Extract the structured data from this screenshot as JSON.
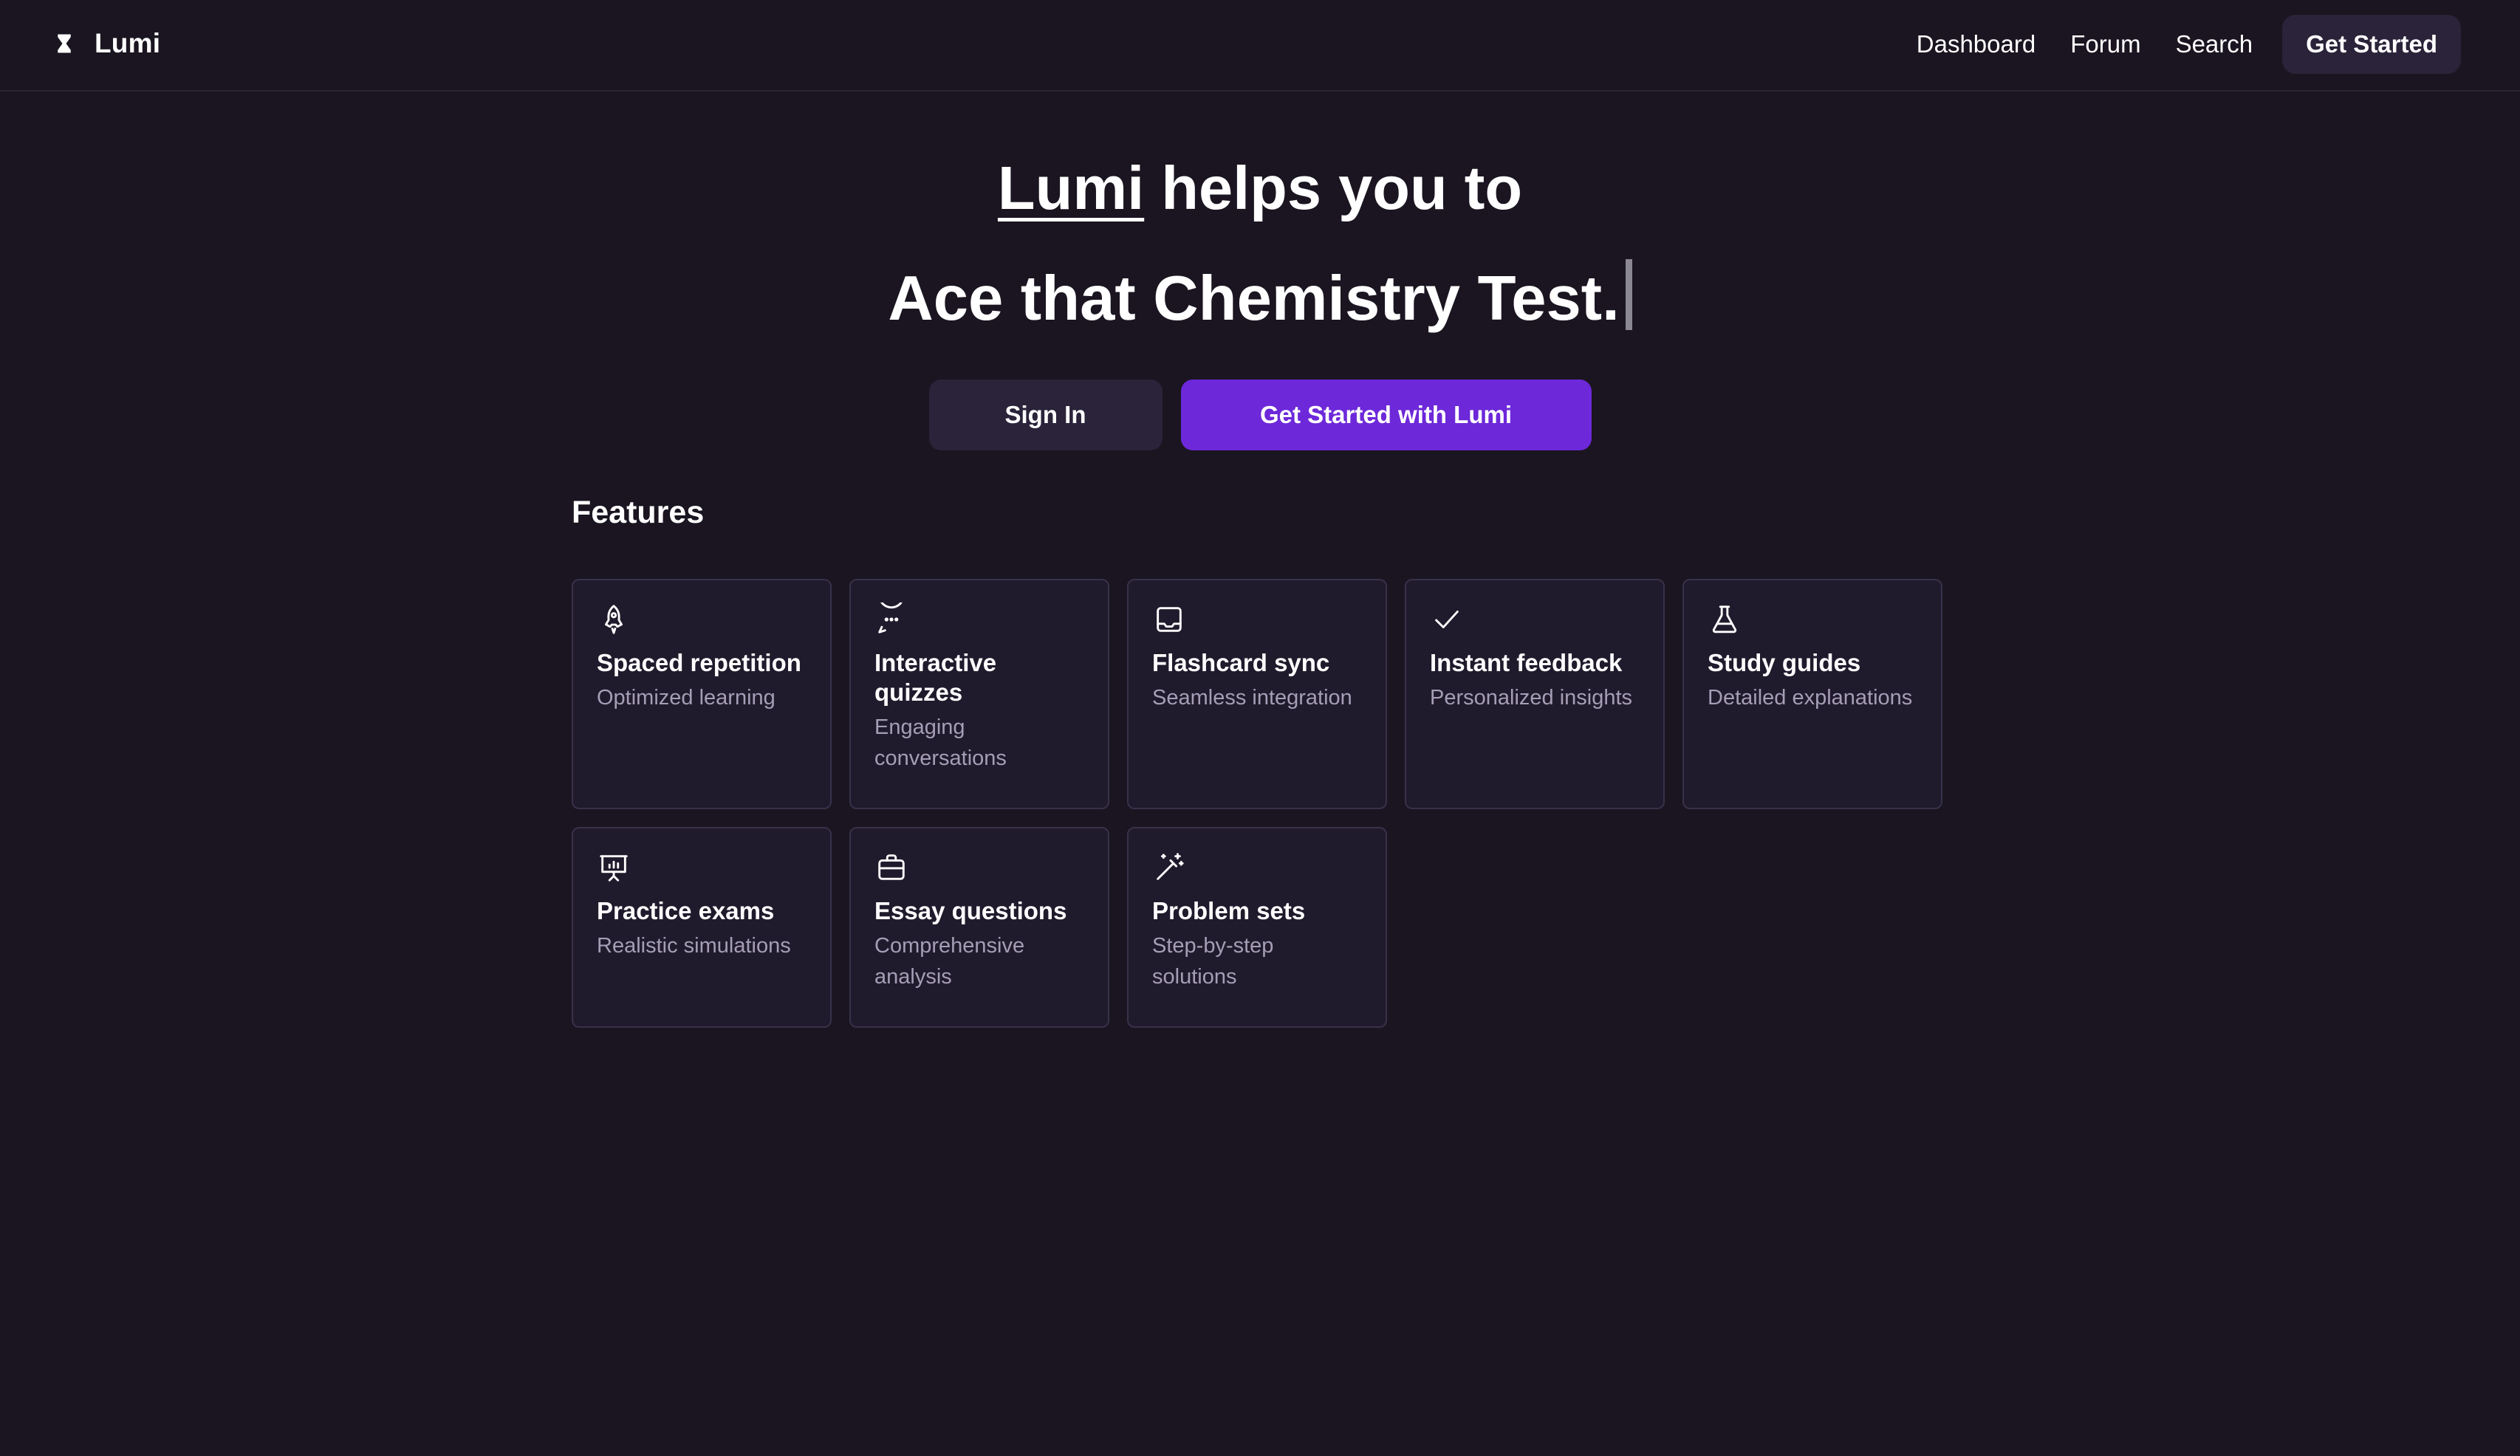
{
  "header": {
    "brand": "Lumi",
    "brand_icon": "hourglass-icon",
    "nav": [
      {
        "label": "Dashboard"
      },
      {
        "label": "Forum"
      },
      {
        "label": "Search"
      }
    ],
    "cta_label": "Get Started"
  },
  "hero": {
    "brand_word": "Lumi",
    "line1_rest": " helps you to",
    "line2": "Ace that Chemistry Test."
  },
  "actions": {
    "sign_in": "Sign In",
    "get_started": "Get Started with Lumi"
  },
  "features": {
    "title": "Features",
    "items": [
      {
        "icon": "rocket-icon",
        "title": "Spaced repetition",
        "desc": "Optimized learning"
      },
      {
        "icon": "chat-bubble-icon",
        "title": "Interactive quizzes",
        "desc": "Engaging conversations"
      },
      {
        "icon": "inbox-icon",
        "title": "Flashcard sync",
        "desc": "Seamless integration"
      },
      {
        "icon": "checkmark-icon",
        "title": "Instant feedback",
        "desc": "Personalized insights"
      },
      {
        "icon": "flask-icon",
        "title": "Study guides",
        "desc": "Detailed explanations"
      },
      {
        "icon": "presentation-chart-icon",
        "title": "Practice exams",
        "desc": "Realistic simulations"
      },
      {
        "icon": "briefcase-icon",
        "title": "Essay questions",
        "desc": "Comprehensive analysis"
      },
      {
        "icon": "magic-wand-icon",
        "title": "Problem sets",
        "desc": "Step-by-step solutions"
      }
    ]
  },
  "colors": {
    "background": "#1a1520",
    "card": "#201b2c",
    "card_border": "#37314a",
    "accent": "#6d28d9",
    "secondary_button": "#2a2339",
    "muted_text": "#a59eb6"
  }
}
